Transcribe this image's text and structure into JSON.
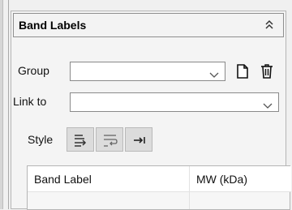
{
  "panel": {
    "title": "Band Labels"
  },
  "group": {
    "label": "Group",
    "value": ""
  },
  "link_to": {
    "label": "Link to",
    "value": ""
  },
  "style": {
    "label": "Style"
  },
  "table": {
    "columns": [
      "Band Label",
      "MW (kDa)"
    ]
  }
}
